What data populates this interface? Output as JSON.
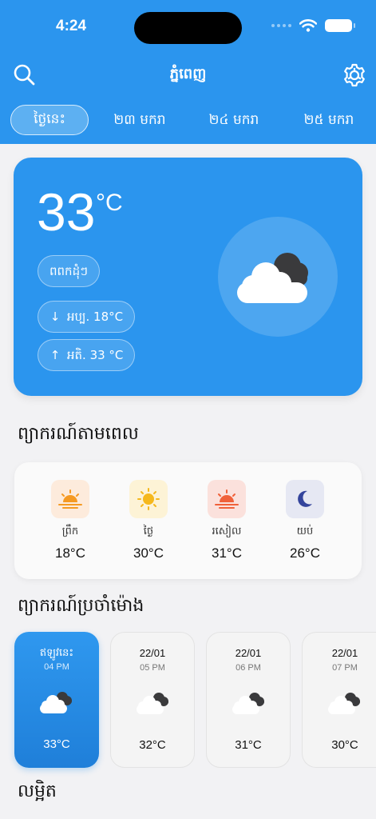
{
  "status_bar": {
    "time": "4:24"
  },
  "nav": {
    "title": "ភ្នំពេញ"
  },
  "tabs": [
    {
      "label": "ថ្ងៃនេះ",
      "active": true
    },
    {
      "label": "២៣ មករា",
      "active": false
    },
    {
      "label": "២៤ មករា",
      "active": false
    },
    {
      "label": "២៥ មករា",
      "active": false
    }
  ],
  "today": {
    "temperature": "33",
    "unit": "°C",
    "condition": "ពពកដុំៗ",
    "min_label": "អប្ប. 18°C",
    "max_label": "អតិ. 33 °C"
  },
  "period_section": {
    "title": "ព្យាករណ៍តាមពេល",
    "items": [
      {
        "name": "ព្រឹក",
        "temp": "18°C",
        "icon": "sunrise-icon"
      },
      {
        "name": "ថ្ងៃ",
        "temp": "30°C",
        "icon": "sun-icon"
      },
      {
        "name": "រសៀល",
        "temp": "31°C",
        "icon": "sunset-icon"
      },
      {
        "name": "យប់",
        "temp": "26°C",
        "icon": "moon-icon"
      }
    ]
  },
  "hourly_section": {
    "title": "ព្យាករណ៍ប្រចាំម៉ោង",
    "items": [
      {
        "date": "ឥឡូវនេះ",
        "time": "04 PM",
        "temp": "33°C",
        "active": true
      },
      {
        "date": "22/01",
        "time": "05 PM",
        "temp": "32°C",
        "active": false
      },
      {
        "date": "22/01",
        "time": "06 PM",
        "temp": "31°C",
        "active": false
      },
      {
        "date": "22/01",
        "time": "07 PM",
        "temp": "30°C",
        "active": false
      }
    ]
  },
  "details_section": {
    "title": "លម្អិត"
  },
  "colors": {
    "primary": "#2b95ee",
    "background": "#f2f2f4",
    "card": "#fafafa"
  }
}
